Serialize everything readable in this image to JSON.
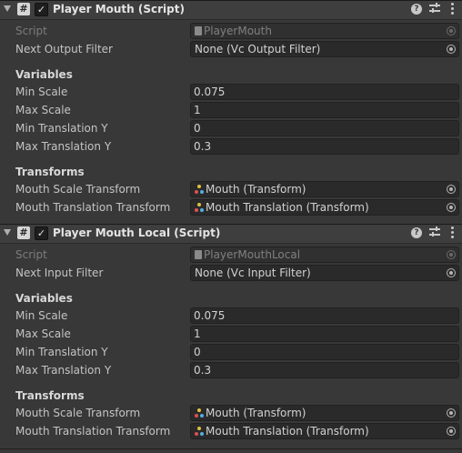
{
  "components": [
    {
      "title": "Player Mouth (Script)",
      "enabled": true,
      "script_label": "Script",
      "script_value": "PlayerMouth",
      "filter_label": "Next Output Filter",
      "filter_value": "None (Vc Output Filter)",
      "variables_header": "Variables",
      "min_scale_label": "Min Scale",
      "min_scale_value": "0.075",
      "max_scale_label": "Max Scale",
      "max_scale_value": "1",
      "min_ty_label": "Min Translation Y",
      "min_ty_value": "0",
      "max_ty_label": "Max Translation Y",
      "max_ty_value": "0.3",
      "transforms_header": "Transforms",
      "scale_tf_label": "Mouth Scale Transform",
      "scale_tf_value": "Mouth (Transform)",
      "trans_tf_label": "Mouth Translation Transform",
      "trans_tf_value": "Mouth Translation (Transform)"
    },
    {
      "title": "Player Mouth Local (Script)",
      "enabled": true,
      "script_label": "Script",
      "script_value": "PlayerMouthLocal",
      "filter_label": "Next Input Filter",
      "filter_value": "None (Vc Input Filter)",
      "variables_header": "Variables",
      "min_scale_label": "Min Scale",
      "min_scale_value": "0.075",
      "max_scale_label": "Max Scale",
      "max_scale_value": "1",
      "min_ty_label": "Min Translation Y",
      "min_ty_value": "0",
      "max_ty_label": "Max Translation Y",
      "max_ty_value": "0.3",
      "transforms_header": "Transforms",
      "scale_tf_label": "Mouth Scale Transform",
      "scale_tf_value": "Mouth (Transform)",
      "trans_tf_label": "Mouth Translation Transform",
      "trans_tf_value": "Mouth Translation (Transform)"
    }
  ],
  "icons": {
    "script": "hash-script-icon",
    "help": "help-icon",
    "presets": "presets-icon",
    "menu": "kebab-menu-icon",
    "object_picker": "object-picker-icon",
    "transform": "transform-icon",
    "script_asset": "script-asset-icon"
  }
}
